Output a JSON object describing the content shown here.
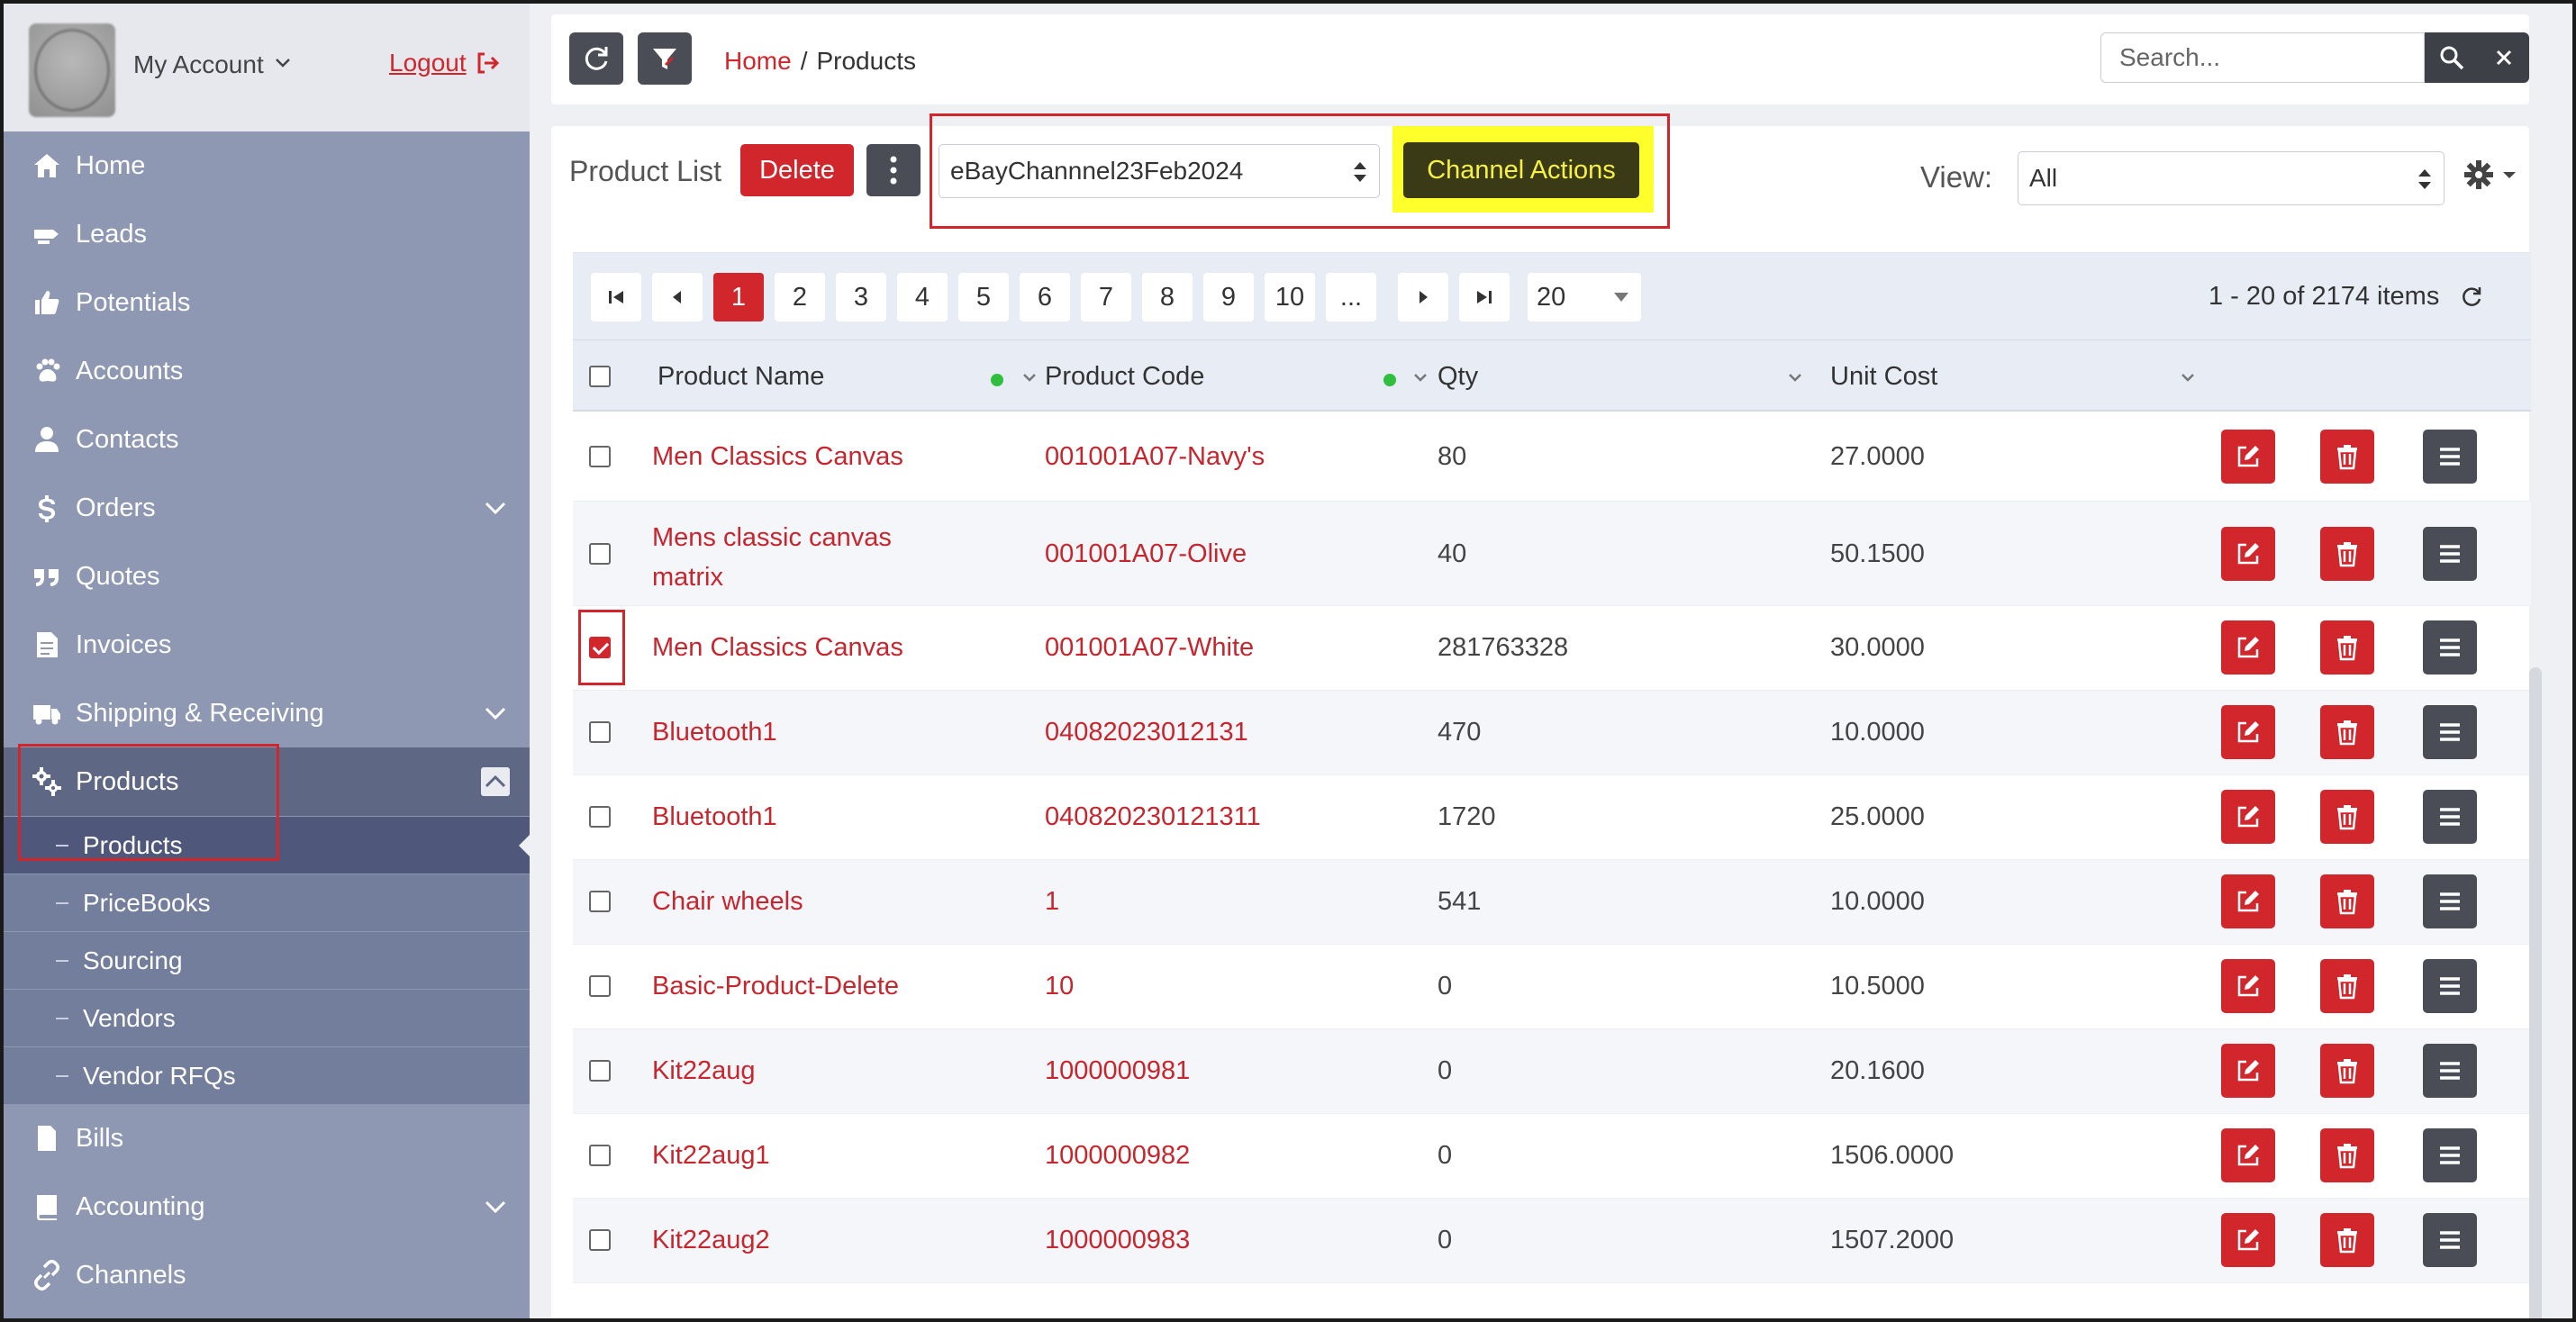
{
  "sidebar": {
    "account_label": "My Account",
    "logout_label": "Logout",
    "nav": [
      {
        "label": "Home",
        "icon": "home-icon"
      },
      {
        "label": "Leads",
        "icon": "leads-icon"
      },
      {
        "label": "Potentials",
        "icon": "thumbs-up-icon"
      },
      {
        "label": "Accounts",
        "icon": "paw-icon"
      },
      {
        "label": "Contacts",
        "icon": "user-icon"
      },
      {
        "label": "Orders",
        "icon": "dollar-icon"
      },
      {
        "label": "Quotes",
        "icon": "quote-icon"
      },
      {
        "label": "Invoices",
        "icon": "invoice-icon"
      },
      {
        "label": "Shipping & Receiving",
        "icon": "truck-icon"
      },
      {
        "label": "Products",
        "icon": "gears-icon"
      },
      {
        "label": "Bills",
        "icon": "bill-icon"
      },
      {
        "label": "Accounting",
        "icon": "book-icon"
      },
      {
        "label": "Channels",
        "icon": "link-icon"
      }
    ],
    "sub_nav": [
      {
        "label": "Products"
      },
      {
        "label": "PriceBooks"
      },
      {
        "label": "Sourcing"
      },
      {
        "label": "Vendors"
      },
      {
        "label": "Vendor RFQs"
      }
    ]
  },
  "topbar": {
    "breadcrumb_home": "Home",
    "breadcrumb_sep": "/",
    "breadcrumb_current": "Products",
    "search_placeholder": "Search..."
  },
  "toolbar": {
    "title": "Product List",
    "delete_label": "Delete",
    "channel_value": "eBayChannnel23Feb2024",
    "channel_actions_label": "Channel Actions",
    "view_label": "View:",
    "view_value": "All"
  },
  "pager": {
    "pages": [
      "1",
      "2",
      "3",
      "4",
      "5",
      "6",
      "7",
      "8",
      "9",
      "10",
      "..."
    ],
    "current_page": "1",
    "page_size": "20",
    "items_info": "1 - 20 of 2174 items"
  },
  "table": {
    "columns": [
      "Product Name",
      "Product Code",
      "Qty",
      "Unit Cost"
    ],
    "rows": [
      {
        "name": "Men Classics Canvas",
        "code": "001001A07-Navy's",
        "qty": "80",
        "cost": "27.0000",
        "checked": false
      },
      {
        "name": "Mens classic canvas matrix",
        "code": "001001A07-Olive",
        "qty": "40",
        "cost": "50.1500",
        "checked": false
      },
      {
        "name": "Men Classics Canvas",
        "code": "001001A07-White",
        "qty": "281763328",
        "cost": "30.0000",
        "checked": true
      },
      {
        "name": "Bluetooth1",
        "code": "04082023012131",
        "qty": "470",
        "cost": "10.0000",
        "checked": false
      },
      {
        "name": "Bluetooth1",
        "code": "040820230121311",
        "qty": "1720",
        "cost": "25.0000",
        "checked": false
      },
      {
        "name": "Chair wheels",
        "code": "1",
        "qty": "541",
        "cost": "10.0000",
        "checked": false
      },
      {
        "name": "Basic-Product-Delete",
        "code": "10",
        "qty": "0",
        "cost": "10.5000",
        "checked": false
      },
      {
        "name": "Kit22aug",
        "code": "1000000981",
        "qty": "0",
        "cost": "20.1600",
        "checked": false
      },
      {
        "name": "Kit22aug1",
        "code": "1000000982",
        "qty": "0",
        "cost": "1506.0000",
        "checked": false
      },
      {
        "name": "Kit22aug2",
        "code": "1000000983",
        "qty": "0",
        "cost": "1507.2000",
        "checked": false
      }
    ]
  },
  "colors": {
    "accent_red": "#d0262c",
    "sidebar_bg": "#8e98b3",
    "highlight_yellow": "#ffff2b"
  }
}
